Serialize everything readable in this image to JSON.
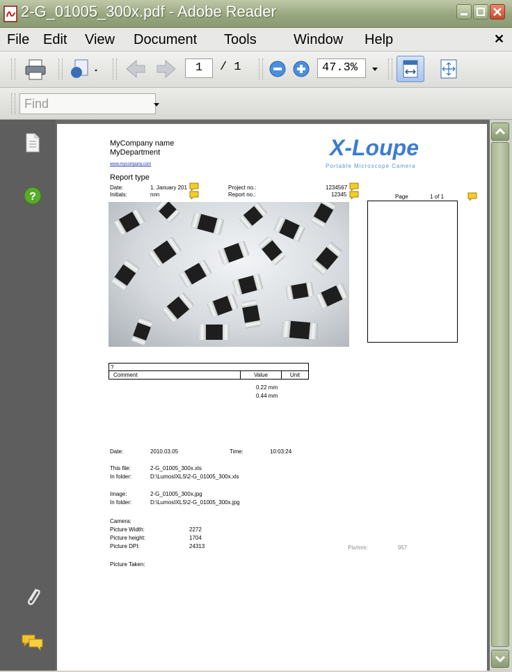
{
  "window": {
    "title": "2-G_01005_300x.pdf - Adobe Reader"
  },
  "menu": {
    "items": [
      "File",
      "Edit",
      "View",
      "Document",
      "Tools",
      "Window",
      "Help"
    ]
  },
  "toolbar": {
    "page_current": "1",
    "page_total": "/ 1",
    "zoom": "47.3%"
  },
  "find": {
    "placeholder": "Find"
  },
  "doc": {
    "company": "MyCompany name",
    "department": "MyDepartment",
    "website": "www.mycompany.com",
    "brand": "X-Loupe",
    "brand_sub": "Portable Microscope Camera",
    "report_type": "Report type",
    "date_label": "Date:",
    "date_value": "1. January 201",
    "initials_label": "Initials:",
    "initials_value": "nnn",
    "project_label": "Project no.:",
    "project_value": "1234567",
    "report_label": "Report no.:",
    "report_value": "12345",
    "page_label": "Page",
    "page_value": "1 of 1",
    "table_title": "?",
    "table_headers": [
      "Comment",
      "Value",
      "Unit"
    ],
    "measurements": [
      "0.22 mm",
      "0.44 mm"
    ],
    "info_date_label": "Date:",
    "info_date": "2010.03.05",
    "info_time_label": "Time:",
    "info_time": "10:03:24",
    "file_label": "This file:",
    "file_value": "2-G_01005_300x.xls",
    "folder_label": "In folder:",
    "folder_value": "D:\\LumosIXLS\\2-G_01005_300x.xls",
    "image_label": "Image:",
    "image_value": "2-G_01005_300x.jpg",
    "img_folder_label": "In folder:",
    "img_folder_value": "D:\\LumosIXLS\\2-G_01005_300x.jpg",
    "camera_label": "Camera:",
    "pw_label": "Picture Width:",
    "pw_value": "2272",
    "ph_label": "Picture height:",
    "ph_value": "1704",
    "dpi_label": "Picture DPI:",
    "dpi_value": "24313",
    "pixmm_label": "Pix/mm:",
    "pixmm_value": "957",
    "taken_label": "Picture Taken:"
  }
}
